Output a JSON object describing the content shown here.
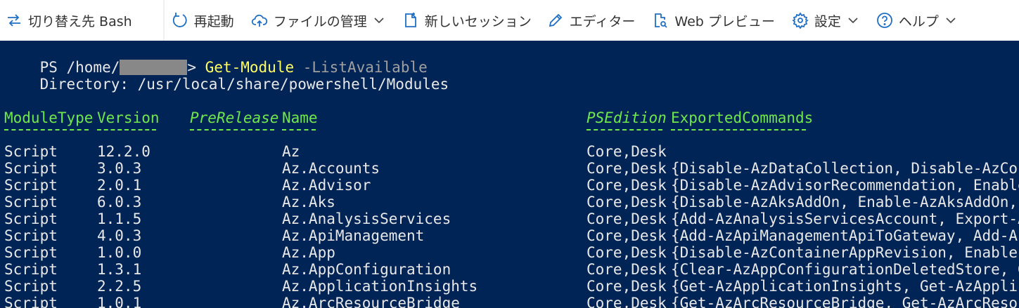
{
  "toolbar": {
    "items": [
      {
        "name": "switch-shell",
        "icon": "switch-arrows-icon",
        "label": "切り替え先 Bash",
        "chevron": false
      },
      {
        "name": "restart",
        "icon": "restart-icon",
        "label": "再起動",
        "chevron": false
      },
      {
        "name": "manage-files",
        "icon": "cloud-upload-icon",
        "label": "ファイルの管理",
        "chevron": true
      },
      {
        "name": "new-session",
        "icon": "new-session-icon",
        "label": "新しいセッション",
        "chevron": false
      },
      {
        "name": "editor",
        "icon": "pencil-icon",
        "label": "エディター",
        "chevron": false
      },
      {
        "name": "web-preview",
        "icon": "web-preview-icon",
        "label": "Web プレビュー",
        "chevron": false
      },
      {
        "name": "settings",
        "icon": "gear-icon",
        "label": "設定",
        "chevron": true
      },
      {
        "name": "help",
        "icon": "help-icon",
        "label": "ヘルプ",
        "chevron": true
      }
    ]
  },
  "terminal": {
    "prompt_prefix": "PS /home/",
    "prompt_suffix": "> ",
    "command": "Get-Module",
    "parameter": " -ListAvailable",
    "directory_line": "    Directory: /usr/local/share/powershell/Modules",
    "headers": [
      "ModuleType",
      "Version",
      "PreRelease",
      "Name",
      "PSEdition",
      "ExportedCommands"
    ],
    "header_underlines": [
      "----------",
      "-------",
      "----------",
      "----",
      "---------",
      "----------------"
    ],
    "rows": [
      [
        "Script",
        "12.2.0",
        "",
        "Az",
        "Core,Desk",
        ""
      ],
      [
        "Script",
        "3.0.3",
        "",
        "Az.Accounts",
        "Core,Desk",
        "{Disable-AzDataCollection, Disable-AzConte"
      ],
      [
        "Script",
        "2.0.1",
        "",
        "Az.Advisor",
        "Core,Desk",
        "{Disable-AzAdvisorRecommendation, Enable-A"
      ],
      [
        "Script",
        "6.0.3",
        "",
        "Az.Aks",
        "Core,Desk",
        "{Disable-AzAksAddOn, Enable-AzAksAddOn, Ge"
      ],
      [
        "Script",
        "1.1.5",
        "",
        "Az.AnalysisServices",
        "Core,Desk",
        "{Add-AzAnalysisServicesAccount, Export-Az"
      ],
      [
        "Script",
        "4.0.3",
        "",
        "Az.ApiManagement",
        "Core,Desk",
        "{Add-AzApiManagementApiToGateway, Add-AzAp"
      ],
      [
        "Script",
        "1.0.0",
        "",
        "Az.App",
        "Core,Desk",
        "{Disable-AzContainerAppRevision, Enable-Az"
      ],
      [
        "Script",
        "1.3.1",
        "",
        "Az.AppConfiguration",
        "Core,Desk",
        "{Clear-AzAppConfigurationDeletedStore, Get"
      ],
      [
        "Script",
        "2.2.5",
        "",
        "Az.ApplicationInsights",
        "Core,Desk",
        "{Get-AzApplicationInsights, Get-AzApplicat"
      ],
      [
        "Script",
        "1.0.1",
        "",
        "Az.ArcResourceBridge",
        "Core,Desk",
        "{Get-AzArcResourceBridge, Get-AzArcResourc"
      ]
    ]
  },
  "colors": {
    "terminal_bg": "#012456",
    "command": "#ffff5f",
    "header": "#6ee84a",
    "toolbar_bg": "#ffffff"
  }
}
